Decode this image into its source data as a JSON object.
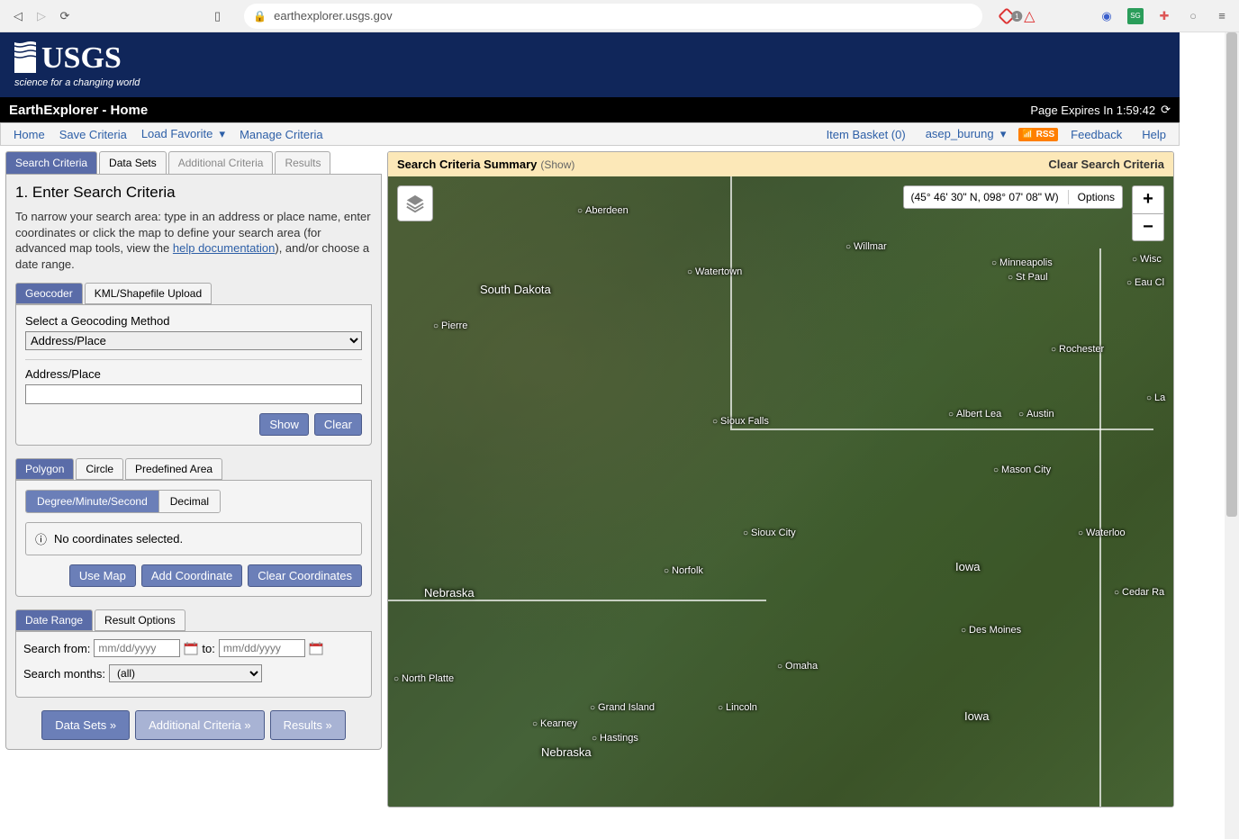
{
  "browser": {
    "url": "earthexplorer.usgs.gov"
  },
  "header": {
    "logo_text": "USGS",
    "tagline": "science for a changing world"
  },
  "blackbar": {
    "title": "EarthExplorer - Home",
    "expires": "Page Expires In 1:59:42"
  },
  "menu": {
    "home": "Home",
    "save": "Save Criteria",
    "load": "Load Favorite",
    "manage": "Manage Criteria",
    "basket": "Item Basket (0)",
    "user": "asep_burung",
    "rss": "RSS",
    "feedback": "Feedback",
    "help": "Help"
  },
  "tabs": {
    "search": "Search Criteria",
    "datasets": "Data Sets",
    "additional": "Additional Criteria",
    "results": "Results"
  },
  "panel": {
    "heading": "1. Enter Search Criteria",
    "intro1": "To narrow your search area: type in an address or place name, enter coordinates or click the map to define your search area (for advanced map tools, view the ",
    "help_link": "help documentation",
    "intro2": "), and/or choose a date range."
  },
  "geocoder": {
    "tab_geocoder": "Geocoder",
    "tab_upload": "KML/Shapefile Upload",
    "method_label": "Select a Geocoding Method",
    "method_value": "Address/Place",
    "address_label": "Address/Place",
    "show": "Show",
    "clear": "Clear"
  },
  "area": {
    "tab_polygon": "Polygon",
    "tab_circle": "Circle",
    "tab_predef": "Predefined Area",
    "fmt_dms": "Degree/Minute/Second",
    "fmt_dec": "Decimal",
    "no_coords": "No coordinates selected.",
    "use_map": "Use Map",
    "add_coord": "Add Coordinate",
    "clear_coords": "Clear Coordinates"
  },
  "date": {
    "tab_range": "Date Range",
    "tab_result": "Result Options",
    "from_label": "Search from:",
    "to_label": "to:",
    "placeholder": "mm/dd/yyyy",
    "months_label": "Search months:",
    "months_value": "(all)"
  },
  "navbtns": {
    "datasets": "Data Sets »",
    "additional": "Additional Criteria »",
    "results": "Results »"
  },
  "summary": {
    "title": "Search Criteria Summary",
    "show": "(Show)",
    "clear": "Clear Search Criteria"
  },
  "map": {
    "coords": "(45° 46' 30\" N, 098° 07' 08\" W)",
    "options": "Options",
    "cities": {
      "aberdeen": "Aberdeen",
      "willmar": "Willmar",
      "minneapolis": "Minneapolis",
      "stpaul": "St Paul",
      "wisc": "Wisc",
      "eaucl": "Eau Cl",
      "watertown": "Watertown",
      "pierre": "Pierre",
      "rochester": "Rochester",
      "la": "La",
      "siouxfalls": "Sioux Falls",
      "albertlea": "Albert Lea",
      "austin": "Austin",
      "masoncity": "Mason City",
      "siouxcity": "Sioux City",
      "waterloo": "Waterloo",
      "norfolk": "Norfolk",
      "cedarra": "Cedar Ra",
      "desmoines": "Des Moines",
      "northplatte": "North Platte",
      "omaha": "Omaha",
      "grandisland": "Grand Island",
      "lincoln": "Lincoln",
      "kearney": "Kearney",
      "hastings": "Hastings"
    },
    "states": {
      "sd": "South Dakota",
      "nebraska": "Nebraska",
      "nebraska2": "Nebraska",
      "iowa": "Iowa",
      "iowa2": "Iowa"
    }
  }
}
